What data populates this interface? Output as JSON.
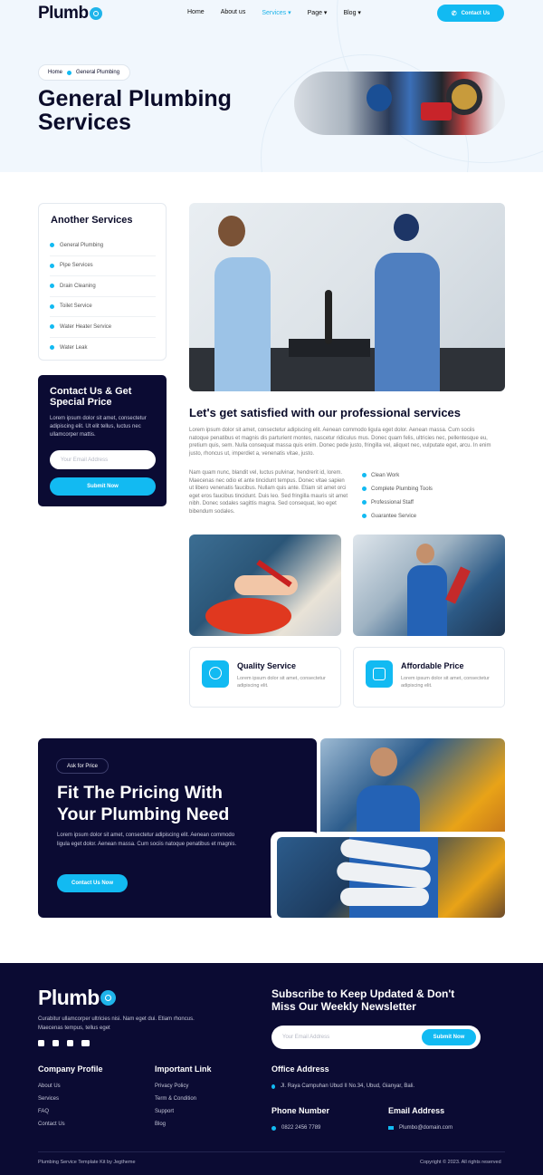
{
  "brand": {
    "name": "Plumb"
  },
  "nav": {
    "items": [
      {
        "label": "Home"
      },
      {
        "label": "About us"
      },
      {
        "label": "Services ▾"
      },
      {
        "label": "Page ▾"
      },
      {
        "label": "Blog ▾"
      }
    ],
    "cta": "Contact Us"
  },
  "hero": {
    "breadcrumb": [
      "Home",
      "General Plumbing"
    ],
    "title": "General Plumbing Services"
  },
  "sidebar": {
    "services_title": "Another Services",
    "services": [
      "General Plumbing",
      "Pipe Services",
      "Drain Cleaning",
      "Toilet Service",
      "Water Heater Service",
      "Water Leak"
    ],
    "contact_title": "Contact Us & Get Special Price",
    "contact_text": "Lorem ipsum dolor sit amet, consectetur adipiscing elit. Ut elit tellus, luctus nec ullamcorper mattis.",
    "email_placeholder": "Your Email Address",
    "submit": "Submit Now"
  },
  "content": {
    "heading": "Let's get satisfied with our professional services",
    "para1": "Lorem ipsum dolor sit amet, consectetur adipiscing elit. Aenean commodo ligula eget dolor. Aenean massa. Cum sociis natoque penatibus et magnis dis parturient montes, nascetur ridiculus mus. Donec quam felis, ultricies nec, pellentesque eu, pretium quis, sem. Nulla consequat massa quis enim. Donec pede justo, fringilla vel, aliquet nec, vulputate eget, arcu. In enim justo, rhoncus ut, imperdiet a, venenatis vitae, justo.",
    "para2": "Nam quam nunc, blandit vel, luctus pulvinar, hendrerit id, lorem. Maecenas nec odio et ante tincidunt tempus. Donec vitae sapien ut libero venenatis faucibus. Nullam quis ante. Etiam sit amet orci eget eros faucibus tincidunt. Duis leo. Sed fringilla mauris sit amet nibh. Donec sodales sagittis magna. Sed consequat, leo eget bibendum sodales.",
    "checks": [
      "Clean Work",
      "Complete Plumbing Tools",
      "Professional Staff",
      "Guarantee Service"
    ],
    "features": [
      {
        "title": "Quality Service",
        "desc": "Lorem ipsum dolor sit amet, consectetur adipiscing elit."
      },
      {
        "title": "Affordable Price",
        "desc": "Lorem ipsum dolor sit amet, consectetur adipiscing elit."
      }
    ]
  },
  "pricing": {
    "badge": "Ask for Price",
    "title": "Fit The Pricing With Your Plumbing Need",
    "text": "Lorem ipsum dolor sit amet, consectetur adipiscing elit. Aenean commodo ligula eget dolor. Aenean massa. Cum sociis natoque penatibus et magnis.",
    "cta": "Contact Us Now"
  },
  "footer": {
    "brand": "Plumb",
    "about": "Curabitur ullamcorper ultricies nisi. Nam eget dui. Etiam rhoncus. Maecenas tempus, tellus eget",
    "newsletter_title": "Subscribe to Keep Updated & Don't Miss Our Weekly Newsletter",
    "email_placeholder": "Your Email Address",
    "subscribe": "Submit Now",
    "company_title": "Company Profile",
    "company_links": [
      "About Us",
      "Services",
      "FAQ",
      "Contact Us"
    ],
    "important_title": "Important Link",
    "important_links": [
      "Privacy Policy",
      "Term & Condition",
      "Support",
      "Blog"
    ],
    "office_title": "Office Address",
    "office": "Jl. Raya Campuhan Ubud II No.34, Ubud, Gianyar, Bali.",
    "phone_title": "Phone Number",
    "phone": "0822 2456 7789",
    "email_title": "Email Address",
    "email": "Plumbo@domain.com",
    "credit": "Plumbing Service Template Kit by Jegtheme",
    "copyright": "Copyright © 2023. All rights reserved"
  },
  "colors": {
    "accent": "#12baf2",
    "navy": "#0b0b33",
    "hero_bg": "#f1f7fd"
  },
  "icons": [
    "gear-icon",
    "phone-icon",
    "chevron-icon",
    "check-icon",
    "award-icon",
    "price-icon",
    "pin-icon",
    "mail-icon",
    "facebook-icon",
    "twitter-icon",
    "instagram-icon",
    "youtube-icon"
  ]
}
